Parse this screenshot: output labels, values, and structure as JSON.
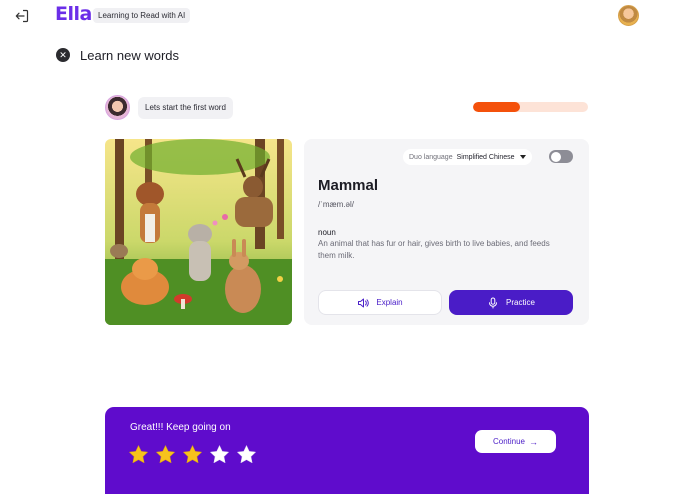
{
  "header": {
    "logo": "Ella",
    "tagline": "Learning to Read with AI",
    "logout_icon": "logout-icon",
    "avatar_icon": "user-avatar"
  },
  "page": {
    "title": "Learn new words",
    "close_icon": "close-icon"
  },
  "tutor": {
    "message": "Lets start the first word",
    "avatar_icon": "tutor-avatar"
  },
  "progress": {
    "fraction": 0.41,
    "fill_color": "#f4510b",
    "track_color": "#fde3d7"
  },
  "illustration": {
    "icon": "forest-animals-illustration"
  },
  "word_card": {
    "duo_language_label": "Duo language",
    "duo_language_value": "Simplified Chinese",
    "duo_toggle_on": false,
    "word": "Mammal",
    "phonetic": "/ˈmæm.əl/",
    "part_of_speech": "noun",
    "definition": "An animal that has fur or hair, gives birth to live babies, and feeds them milk.",
    "explain_label": "Explain",
    "practice_label": "Practice"
  },
  "feedback": {
    "message": "Great!!! Keep going on",
    "stars_filled": 3,
    "stars_total": 5,
    "continue_label": "Continue",
    "accent": "#5f0ccc"
  }
}
